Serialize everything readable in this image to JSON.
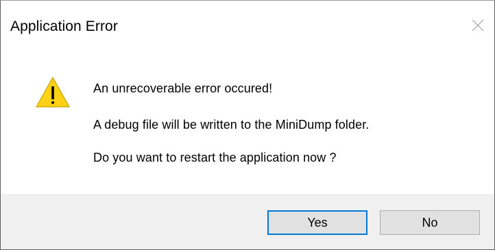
{
  "window": {
    "title": "Application Error",
    "close_icon": "close-icon"
  },
  "message": {
    "icon": "warning-icon",
    "icon_color": "#fcd116",
    "line1": "An unrecoverable error occured!",
    "line2": "A debug file will be written to the MiniDump folder.",
    "line3": "Do you want to restart the application now ?"
  },
  "buttons": {
    "yes_label": "Yes",
    "no_label": "No",
    "focus_color": "#0078d7"
  }
}
